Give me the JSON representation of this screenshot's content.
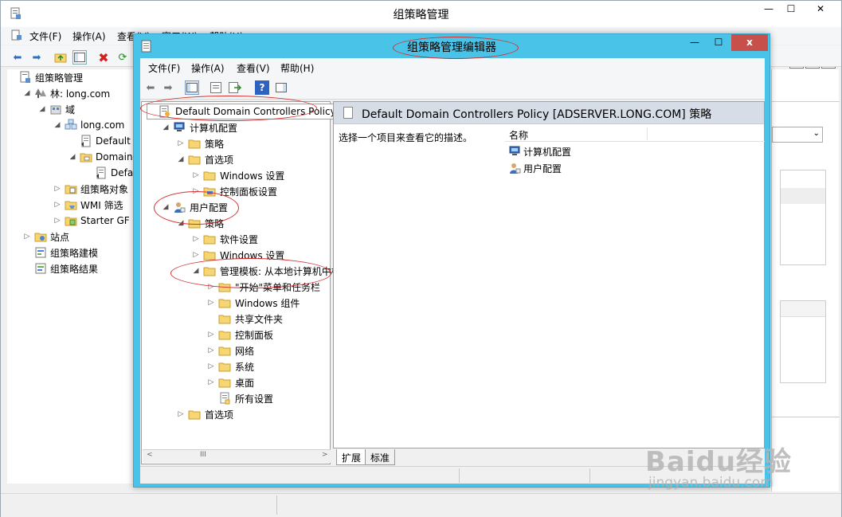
{
  "back_window": {
    "title": "组策略管理",
    "menu": [
      "文件(F)",
      "操作(A)",
      "查看(V)",
      "窗口(W)",
      "帮助(H)"
    ],
    "tree": [
      {
        "label": "组策略管理",
        "icon": "gpm-icon",
        "exp": ""
      },
      {
        "label": "林: long.com",
        "icon": "forest-icon",
        "exp": "◢"
      },
      {
        "label": "域",
        "icon": "domains-icon",
        "exp": "◢"
      },
      {
        "label": "long.com",
        "icon": "domain-icon",
        "exp": "◢"
      },
      {
        "label": "Default D",
        "icon": "gpo-link-icon",
        "exp": ""
      },
      {
        "label": "Domain C",
        "icon": "ou-icon",
        "exp": "◢"
      },
      {
        "label": "Defaul",
        "icon": "gpo-link-icon",
        "exp": ""
      },
      {
        "label": "组策略对象",
        "icon": "gpo-folder-icon",
        "exp": "▷"
      },
      {
        "label": "WMI 筛选",
        "icon": "wmi-folder-icon",
        "exp": "▷"
      },
      {
        "label": "Starter GF",
        "icon": "starter-gpo-icon",
        "exp": "▷"
      },
      {
        "label": "站点",
        "icon": "sites-icon",
        "exp": "▷"
      },
      {
        "label": "组策略建模",
        "icon": "modeling-icon",
        "exp": ""
      },
      {
        "label": "组策略结果",
        "icon": "results-icon",
        "exp": ""
      }
    ]
  },
  "editor": {
    "title": "组策略管理编辑器",
    "close_symbol": "x",
    "menu": [
      "文件(F)",
      "操作(A)",
      "查看(V)",
      "帮助(H)"
    ],
    "toolbar_icons": [
      "back-arrow-icon",
      "forward-arrow-icon",
      "show-tree-icon",
      "properties-icon",
      "export-list-icon",
      "help-icon",
      "action-pane-icon"
    ],
    "tree": [
      {
        "label": "Default Domain Controllers Policy [A",
        "icon": "gpo-icon",
        "exp": "",
        "selected": true
      },
      {
        "label": "计算机配置",
        "icon": "computer-config-icon",
        "exp": "◢"
      },
      {
        "label": "策略",
        "icon": "folder-icon",
        "exp": "▷"
      },
      {
        "label": "首选项",
        "icon": "folder-icon",
        "exp": "◢"
      },
      {
        "label": "Windows 设置",
        "icon": "folder-icon",
        "exp": "▷"
      },
      {
        "label": "控制面板设置",
        "icon": "control-panel-folder-icon",
        "exp": "▷"
      },
      {
        "label": "用户配置",
        "icon": "user-config-icon",
        "exp": "◢"
      },
      {
        "label": "策略",
        "icon": "folder-icon",
        "exp": "◢"
      },
      {
        "label": "软件设置",
        "icon": "folder-icon",
        "exp": "▷"
      },
      {
        "label": "Windows 设置",
        "icon": "folder-icon",
        "exp": "▷"
      },
      {
        "label": "管理模板: 从本地计算机中检",
        "icon": "folder-icon",
        "exp": "◢"
      },
      {
        "label": "\"开始\"菜单和任务栏",
        "icon": "folder-icon",
        "exp": "▷"
      },
      {
        "label": "Windows 组件",
        "icon": "folder-icon",
        "exp": "▷"
      },
      {
        "label": "共享文件夹",
        "icon": "folder-icon",
        "exp": ""
      },
      {
        "label": "控制面板",
        "icon": "folder-icon",
        "exp": "▷"
      },
      {
        "label": "网络",
        "icon": "folder-icon",
        "exp": "▷"
      },
      {
        "label": "系统",
        "icon": "folder-icon",
        "exp": "▷"
      },
      {
        "label": "桌面",
        "icon": "folder-icon",
        "exp": "▷"
      },
      {
        "label": "所有设置",
        "icon": "all-settings-icon",
        "exp": ""
      },
      {
        "label": "首选项",
        "icon": "folder-icon",
        "exp": "▷"
      }
    ],
    "scroll_left": "<",
    "scroll_thumb": "III",
    "scroll_right": ">",
    "header_title": "Default Domain Controllers Policy [ADSERVER.LONG.COM] 策略",
    "description": "选择一个项目来查看它的描述。",
    "column_name": "名称",
    "items": [
      {
        "label": "计算机配置",
        "icon": "computer-config-icon"
      },
      {
        "label": "用户配置",
        "icon": "user-config-icon"
      }
    ],
    "tabs": [
      "扩展",
      "标准"
    ]
  },
  "watermark": {
    "line1": "Baidu经验",
    "line2": "jingyan.baidu.com"
  }
}
